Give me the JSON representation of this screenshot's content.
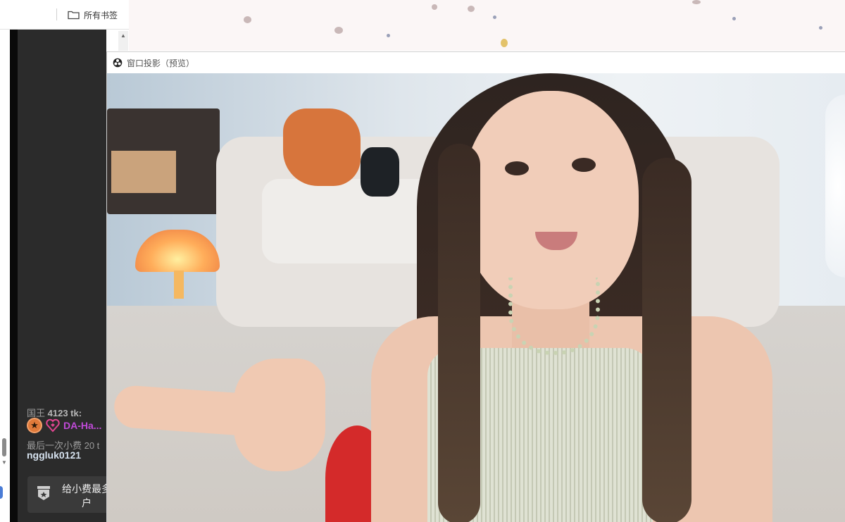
{
  "browser": {
    "bookmarks_label": "所有书签",
    "bookmarks_icon": "folder-icon"
  },
  "projector": {
    "title": "窗口投影（预览）",
    "icon": "obs-logo-icon"
  },
  "chat_panel": {
    "king_label": "国王",
    "king_tokens": "4123 tk:",
    "king_user": "DA-Ha...",
    "last_tip_label": "最后一次小费 20 t",
    "last_tipper": "nggluk0121",
    "tip_button_line1": "给小费最多",
    "tip_button_line2": "户",
    "badge_icons": [
      "star-badge-icon",
      "heart-diamond-badge-icon"
    ],
    "colors": {
      "king_user": "#c04ad8",
      "tipper": "#d6e2ef",
      "panel_bg": "#2b2b2b"
    }
  }
}
